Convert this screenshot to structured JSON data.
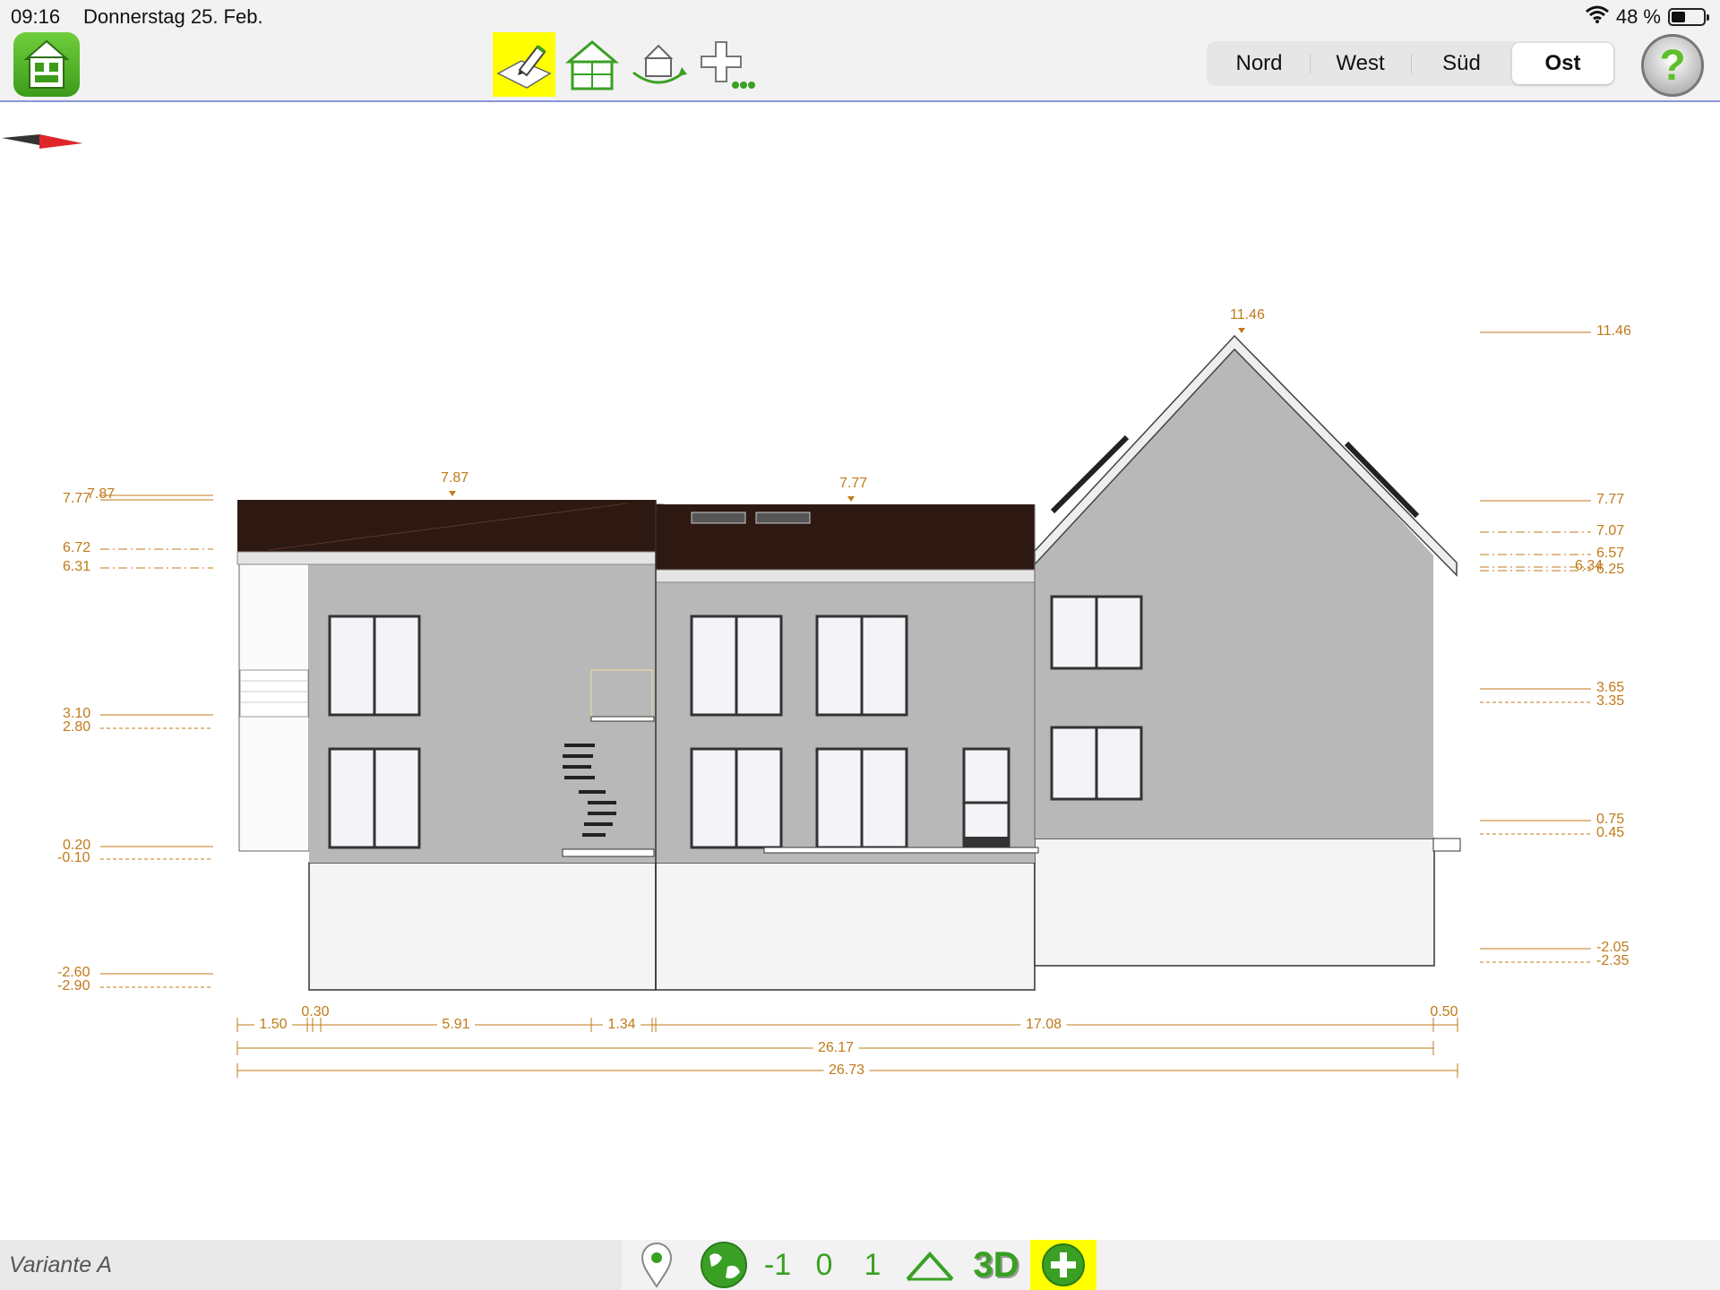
{
  "status": {
    "time": "09:16",
    "date": "Donnerstag 25. Feb.",
    "battery": "48 %",
    "battery_level": 0.48
  },
  "toolbar": {
    "tools": [
      "edit-plan-icon",
      "floorplan-house-icon",
      "rotate-3d-icon",
      "add-more-icon"
    ],
    "active_tool": "edit-plan-icon",
    "views": [
      "Nord",
      "West",
      "Süd",
      "Ost"
    ],
    "selected_view": "Ost",
    "help_label": "?"
  },
  "drawing": {
    "height_labels": {
      "left": [
        {
          "value": "7.87",
          "line": "solid"
        },
        {
          "value": "7.77",
          "line": "solid"
        },
        {
          "value": "6.72",
          "line": "dashdot"
        },
        {
          "value": "6.31",
          "line": "dashdot"
        },
        {
          "value": "3.10",
          "line": "solid"
        },
        {
          "value": "2.80",
          "line": "dashed"
        },
        {
          "value": "0.20",
          "line": "solid"
        },
        {
          "value": "-0.10",
          "line": "dashed"
        },
        {
          "value": "-2.60",
          "line": "solid"
        },
        {
          "value": "-2.90",
          "line": "dashed"
        }
      ],
      "right": [
        {
          "value": "11.46",
          "line": "solid"
        },
        {
          "value": "7.77",
          "line": "solid"
        },
        {
          "value": "7.07",
          "line": "dashdot"
        },
        {
          "value": "6.57",
          "line": "dashdot"
        },
        {
          "value": "6.34",
          "line": "dashdot"
        },
        {
          "value": "6.25",
          "line": "dashdot"
        },
        {
          "value": "3.65",
          "line": "solid"
        },
        {
          "value": "3.35",
          "line": "dashed"
        },
        {
          "value": "0.75",
          "line": "solid"
        },
        {
          "value": "0.45",
          "line": "dashed"
        },
        {
          "value": "-2.05",
          "line": "solid"
        },
        {
          "value": "-2.35",
          "line": "dashed"
        }
      ],
      "ridges": [
        "7.87",
        "7.77",
        "11.46"
      ]
    },
    "dimensions": {
      "row1": [
        "1.50",
        "0.30",
        "5.91",
        "1.34",
        "17.08",
        "0.50"
      ],
      "row2": "26.17",
      "row3": "26.73"
    }
  },
  "bottom": {
    "variant": "Variante A",
    "icons": [
      "location-pin-icon",
      "globe-icon"
    ],
    "levels": [
      "-1",
      "0",
      "1"
    ],
    "roof_icon": "roof-icon",
    "view3d": "3D",
    "add_icon": "add-icon"
  },
  "colors": {
    "accent": "#5fbf2a",
    "highlight": "#ffff00",
    "dimension": "#c07a1a",
    "roof": "#2e1912",
    "wall": "#b8b8b8"
  }
}
